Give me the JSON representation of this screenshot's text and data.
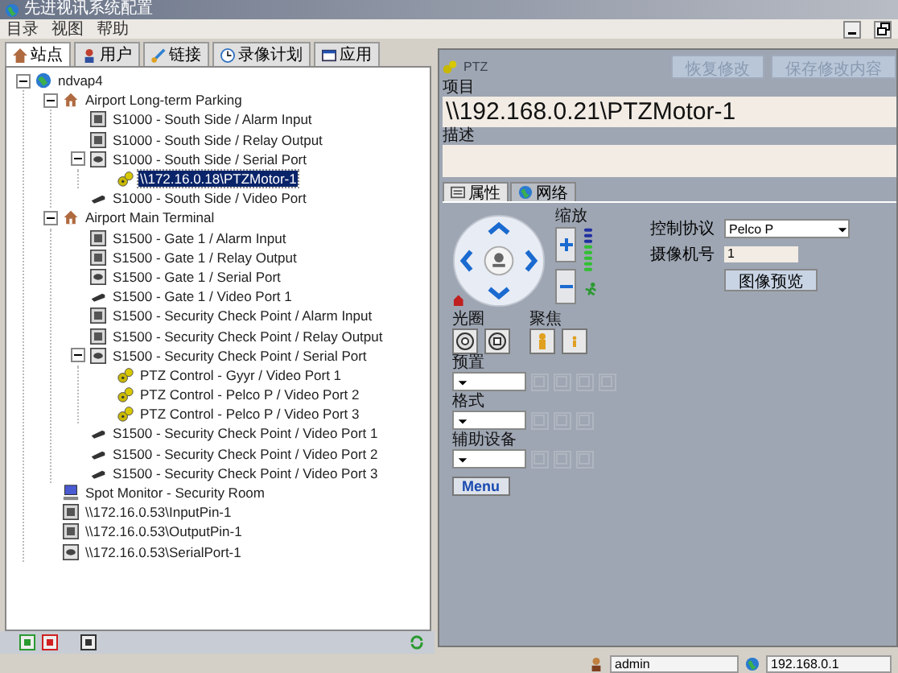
{
  "window": {
    "title": "先进视讯系统配置"
  },
  "menu": [
    "目录",
    "视图",
    "帮助"
  ],
  "left_tabs": [
    {
      "label": "站点",
      "selected": true
    },
    {
      "label": "用户",
      "selected": false
    },
    {
      "label": "链接",
      "selected": false
    },
    {
      "label": "录像计划",
      "selected": false
    },
    {
      "label": "应用",
      "selected": false
    }
  ],
  "tree": [
    {
      "label": "ndvap4",
      "kind": "globe",
      "selected": false,
      "expanded": true,
      "children": [
        {
          "label": "Airport Long-term Parking",
          "kind": "site",
          "selected": false,
          "expanded": true,
          "children": [
            {
              "label": "S1000 - South Side / Alarm Input",
              "kind": "io",
              "selected": false
            },
            {
              "label": "S1000 - South Side / Relay Output",
              "kind": "io",
              "selected": false
            },
            {
              "label": "S1000 - South Side / Serial Port",
              "kind": "serial",
              "selected": false,
              "expanded": true,
              "children": [
                {
                  "label": "\\\\172.16.0.18\\PTZMotor-1",
                  "kind": "ptz",
                  "selected": true
                }
              ]
            },
            {
              "label": "S1000 - South Side / Video Port",
              "kind": "video",
              "selected": false
            }
          ]
        },
        {
          "label": "Airport Main Terminal",
          "kind": "site",
          "selected": false,
          "expanded": true,
          "children": [
            {
              "label": "S1500 - Gate 1 / Alarm Input",
              "kind": "io",
              "selected": false
            },
            {
              "label": "S1500 - Gate 1 / Relay Output",
              "kind": "io",
              "selected": false
            },
            {
              "label": "S1500 - Gate 1 / Serial Port",
              "kind": "serial",
              "selected": false
            },
            {
              "label": "S1500 - Gate 1 / Video Port 1",
              "kind": "video",
              "selected": false
            },
            {
              "label": "S1500 - Security Check Point / Alarm Input",
              "kind": "io",
              "selected": false
            },
            {
              "label": "S1500 - Security Check Point / Relay Output",
              "kind": "io",
              "selected": false
            },
            {
              "label": "S1500 - Security Check Point / Serial Port",
              "kind": "serial",
              "selected": false,
              "expanded": true,
              "children": [
                {
                  "label": "PTZ Control - Gyyr / Video Port 1",
                  "kind": "ptz",
                  "selected": false
                },
                {
                  "label": "PTZ Control - Pelco P / Video Port 2",
                  "kind": "ptz",
                  "selected": false
                },
                {
                  "label": "PTZ Control - Pelco P / Video Port 3",
                  "kind": "ptz",
                  "selected": false
                }
              ]
            },
            {
              "label": "S1500 - Security Check Point / Video Port 1",
              "kind": "video",
              "selected": false
            },
            {
              "label": "S1500 - Security Check Point / Video Port 2",
              "kind": "video",
              "selected": false
            },
            {
              "label": "S1500 - Security Check Point / Video Port 3",
              "kind": "video",
              "selected": false
            }
          ]
        },
        {
          "label": "Spot Monitor - Security Room",
          "kind": "monitor",
          "selected": false
        },
        {
          "label": "\\\\172.16.0.53\\InputPin-1",
          "kind": "io",
          "selected": false
        },
        {
          "label": "\\\\172.16.0.53\\OutputPin-1",
          "kind": "io",
          "selected": false
        },
        {
          "label": "\\\\172.16.0.53\\SerialPort-1",
          "kind": "serial",
          "selected": false
        }
      ]
    }
  ],
  "detail": {
    "type_label": "PTZ",
    "buttons": [
      "恢复修改",
      "保存修改内容"
    ],
    "item_label": "项目",
    "item_value": "\\\\192.168.0.21\\PTZMotor-1",
    "desc_label": "描述",
    "tabs": [
      {
        "label": "属性",
        "selected": true
      },
      {
        "label": "网络",
        "selected": false
      }
    ],
    "zoom_label": "缩放",
    "iris_label": "光圈",
    "focus_label": "聚焦",
    "protocol_label": "控制协议",
    "protocol_value": "Pelco P",
    "camera_label": "摄像机号",
    "camera_value": "1",
    "preview_button": "图像预览",
    "preset_label": "预置",
    "pattern_label": "格式",
    "aux_label": "辅助设备",
    "menu_button": "Menu"
  },
  "status_bar": {
    "user": "admin",
    "server": "192.168.0.1"
  }
}
